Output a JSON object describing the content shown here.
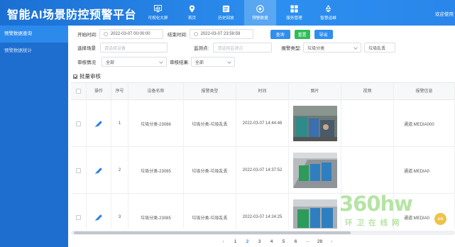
{
  "app": {
    "title": "智能AI场景防控预警平台",
    "welcome": "欢迎使用"
  },
  "nav": [
    {
      "label": "可视化大屏",
      "icon": "chart-icon"
    },
    {
      "label": "首页",
      "icon": "location-pin-icon"
    },
    {
      "label": "历史回放",
      "icon": "history-icon"
    },
    {
      "label": "预警数据",
      "icon": "alert-data-icon",
      "active": true
    },
    {
      "label": "服务管理",
      "icon": "grid-icon"
    },
    {
      "label": "智慧运维",
      "icon": "recycle-icon"
    }
  ],
  "sidebar": {
    "items": [
      {
        "label": "预警数据查询",
        "active": true
      },
      {
        "label": "预警数据统计",
        "active": false
      }
    ]
  },
  "filters": {
    "start_label": "开始时间:",
    "start_value": "2022-03-07 00:00:00",
    "end_label": "结束时间:",
    "end_value": "2022-03-07 23:59:59",
    "query_btn": "查询",
    "reset_btn": "重置",
    "export_btn": "导出",
    "scene_label": "选择场景",
    "scene_placeholder": "请选择设备",
    "monitor_label": "监测点:",
    "monitor_placeholder": "请选择监测点",
    "alarm_type_label": "报警类型:",
    "alarm_type_value": "垃圾分类",
    "alarm_sub_value": "垃圾乱丢",
    "audit_status_label": "审核情况",
    "audit_status_value": "全部",
    "audit_result_label": "审核结果:",
    "audit_result_value": "全部"
  },
  "batch": {
    "label": "批量审核"
  },
  "table": {
    "headers": {
      "op": "操作",
      "index": "序号",
      "device": "设备名称",
      "type": "报警类型",
      "time": "时间",
      "image": "图片",
      "video": "视频",
      "info": "报警信息"
    },
    "rows": [
      {
        "index": "1",
        "device": "垃圾分类-23086",
        "type": "垃圾分类-垃圾乱丢",
        "time": "2022-03-07 14:44:46",
        "info": "通道:MEDIA000"
      },
      {
        "index": "2",
        "device": "垃圾分类-23085",
        "type": "垃圾分类-垃圾乱丢",
        "time": "2022-03-07 14:37:52",
        "info": "通道:MEDIA0"
      },
      {
        "index": "3",
        "device": "垃圾分类-23085",
        "type": "垃圾分类-垃圾乱丢",
        "time": "2022-03-07 14:24:25",
        "info": "通道:MEDIA0"
      }
    ]
  },
  "pager": {
    "prev": "‹",
    "pages": [
      "1",
      "2",
      "3",
      "4",
      "5",
      "6",
      "···",
      "28"
    ],
    "current": "2",
    "next": "›"
  },
  "watermark": {
    "main": "360hw",
    "sub": "环卫在线网",
    "badge": "cn"
  },
  "colors": {
    "header": "#1b6fd3",
    "sidebar": "#1e6ecf",
    "accent": "#2f8ef0",
    "green": "#2ebd57"
  }
}
